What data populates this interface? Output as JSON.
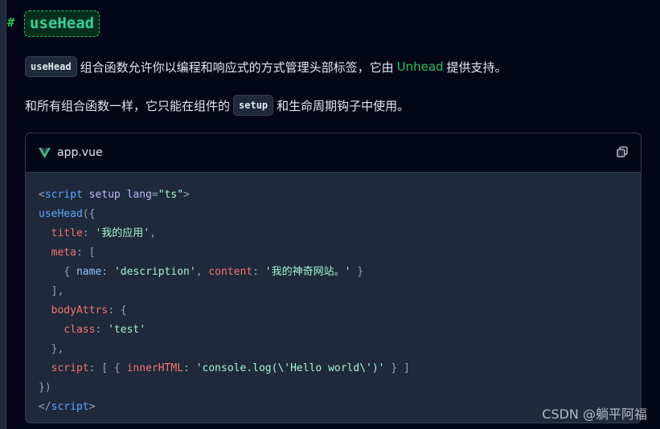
{
  "heading": {
    "anchor": "#",
    "title": "useHead"
  },
  "paragraph1": {
    "code": "useHead",
    "text_before_link": "组合函数允许你以编程和响应式的方式管理头部标签，它由",
    "link": "Unhead",
    "text_after_link": "提供支持。"
  },
  "paragraph2": {
    "text_before_code": "和所有组合函数一样，它只能在组件的",
    "code": "setup",
    "text_after_code": "和生命周期钩子中使用。"
  },
  "codeblock": {
    "filename": "app.vue",
    "file_icon": "vue-logo-icon",
    "copy_icon": "copy-icon",
    "lines": {
      "l1": {
        "open": "<",
        "tag": "script",
        "attr1": " setup",
        "attr2": " lang",
        "eq": "=",
        "val": "\"ts\"",
        "close": ">"
      },
      "l2": {
        "fn": "useHead",
        "rest": "({"
      },
      "l3": {
        "indent": "  ",
        "key": "title",
        "colon": ": ",
        "str": "'我的应用'",
        "comma": ","
      },
      "l4": {
        "indent": "  ",
        "key": "meta",
        "rest": ": ["
      },
      "l5": {
        "indent": "    ",
        "ob": "{ ",
        "k1": "name",
        "c1": ": ",
        "s1": "'description'",
        "sep": ", ",
        "k2": "content",
        "c2": ": ",
        "s2": "'我的神奇网站。'",
        "cb": " }"
      },
      "l6": {
        "text": "  ],"
      },
      "l7": {
        "indent": "  ",
        "key": "bodyAttrs",
        "rest": ": {"
      },
      "l8": {
        "indent": "    ",
        "key": "class",
        "colon": ": ",
        "str": "'test'"
      },
      "l9": {
        "text": "  },"
      },
      "l10": {
        "indent": "  ",
        "key": "script",
        "p1": ": [ { ",
        "k2": "innerHTML",
        "c2": ": ",
        "str": "'console.log(\\'Hello world\\')'",
        "p2": " } ]"
      },
      "l11": {
        "text": "})"
      },
      "l12": {
        "open": "</",
        "tag": "script",
        "close": ">"
      }
    }
  },
  "watermark": "CSDN @躺平阿福",
  "colors": {
    "background": "#020617",
    "accent_green": "#22c55e",
    "code_bg": "#1e293b",
    "border": "#334155"
  }
}
